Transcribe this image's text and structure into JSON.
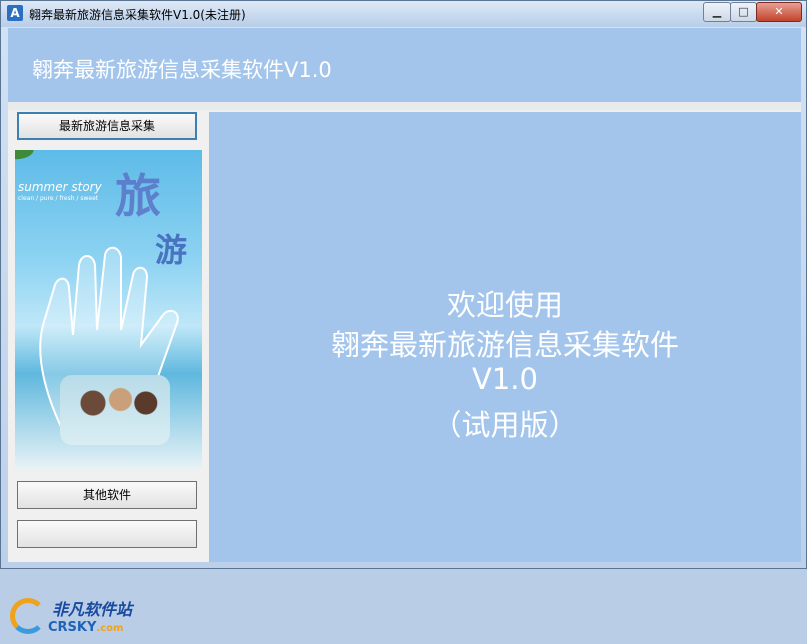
{
  "window": {
    "title": "翱奔最新旅游信息采集软件V1.0(未注册)",
    "icon_text": "A",
    "controls": {
      "minimize": "▁",
      "maximize": "□",
      "close": "✕"
    }
  },
  "header": {
    "title": "翱奔最新旅游信息采集软件V1.0"
  },
  "sidebar": {
    "collect_button": "最新旅游信息采集",
    "picture": {
      "summer": "summer story",
      "tagline": "clean / pure / fresh / sweet",
      "char1": "旅",
      "char2": "游"
    },
    "other_button": "其他软件",
    "third_button": ""
  },
  "main": {
    "line1": "欢迎使用",
    "line2": "翱奔最新旅游信息采集软件",
    "line3": "V1.0",
    "line4": "（试用版）"
  },
  "watermark": {
    "cn": "非凡软件站",
    "en": "CRSKY",
    "en_suffix": ".com"
  },
  "colors": {
    "accent": "#a3c5ec",
    "text_on_accent": "#ffffff"
  }
}
